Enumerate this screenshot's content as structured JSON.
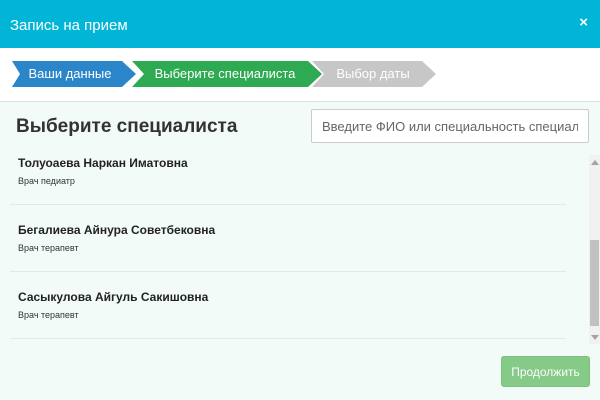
{
  "modal": {
    "title": "Запись на прием",
    "close_label": "×"
  },
  "steps": [
    {
      "label": "Ваши данные",
      "color": "#2a86c8",
      "state": "completed"
    },
    {
      "label": "Выберите специалиста",
      "color": "#2eaa52",
      "state": "active"
    },
    {
      "label": "Выбор даты",
      "color": "#c7c7c7",
      "state": "pending"
    }
  ],
  "main": {
    "title": "Выберите специалиста",
    "search": {
      "placeholder": "Введите ФИО или специальность специалиста",
      "value": ""
    }
  },
  "doctors": [
    {
      "name": "Толуоаева Наркан Иматовна",
      "role": "Врач педиатр"
    },
    {
      "name": "Бегалиева Айнура Советбековна",
      "role": "Врач терапевт"
    },
    {
      "name": "Сасыкулова Айгуль Сакишовна",
      "role": "Врач терапевт"
    }
  ],
  "footer": {
    "continue_label": "Продолжить"
  },
  "colors": {
    "header": "#00b5d6",
    "step_completed": "#2a86c8",
    "step_active": "#2eaa52",
    "step_pending": "#c7c7c7",
    "button": "#5cb85c"
  }
}
